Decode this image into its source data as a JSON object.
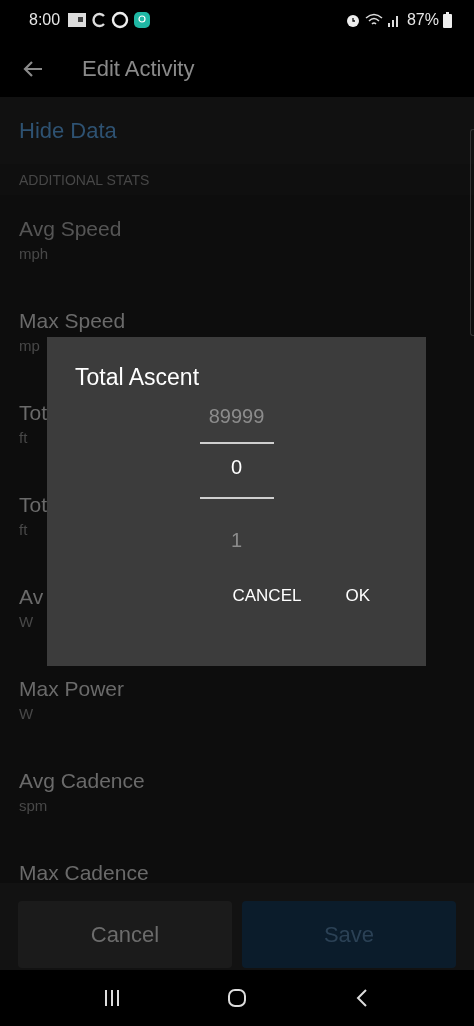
{
  "status_bar": {
    "time": "8:00",
    "battery": "87%"
  },
  "app_bar": {
    "title": "Edit Activity"
  },
  "hide_data": "Hide Data",
  "section_header": "ADDITIONAL STATS",
  "stats": [
    {
      "label": "Avg Speed",
      "unit": "mph"
    },
    {
      "label": "Max Speed",
      "unit": "mp"
    },
    {
      "label": "Tot",
      "unit": "ft"
    },
    {
      "label": "Tot",
      "unit": "ft"
    },
    {
      "label": "Av",
      "unit": "W"
    },
    {
      "label": "Max Power",
      "unit": "W"
    },
    {
      "label": "Avg Cadence",
      "unit": "spm"
    },
    {
      "label": "Max Cadence"
    }
  ],
  "dialog": {
    "title": "Total Ascent",
    "picker": {
      "previous": "89999",
      "value": "0",
      "next": "1"
    },
    "buttons": [
      "CANCEL",
      "OK"
    ]
  },
  "footer_buttons": [
    {
      "label": "Cancel",
      "kind": "secondary"
    },
    {
      "label": "Save",
      "kind": "primary"
    }
  ]
}
